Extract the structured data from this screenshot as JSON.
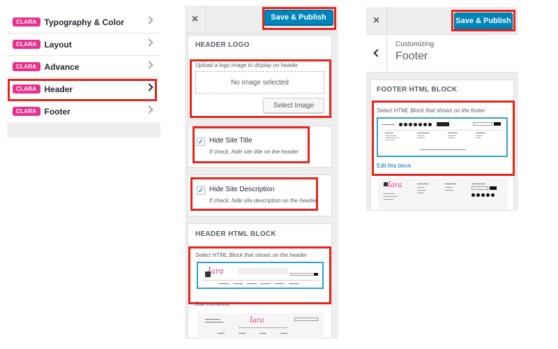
{
  "sections": {
    "badge": "CLARA",
    "items": [
      {
        "label": "Typography & Color"
      },
      {
        "label": "Layout"
      },
      {
        "label": "Advance"
      },
      {
        "label": "Header"
      },
      {
        "label": "Footer"
      }
    ]
  },
  "header_panel": {
    "close": "×",
    "publish": "Save & Publish",
    "logo": {
      "title": "HEADER LOGO",
      "description": "Upload a logo image to display on header",
      "placeholder": "No image selected",
      "select_button": "Select Image"
    },
    "hide_title": {
      "label": "Hide Site Title",
      "description": "If check, hide site title on the header",
      "checked": true
    },
    "hide_description": {
      "label": "Hide Site Description",
      "description": "If check, hide site description on the header",
      "checked": true
    },
    "html_block": {
      "title": "HEADER HTML BLOCK",
      "description": "Select HTML Block that shows on the header",
      "edit_link": "Edit this block"
    }
  },
  "footer_panel": {
    "close": "×",
    "publish": "Save & Publish",
    "breadcrumb": "Customizing",
    "title": "Footer",
    "html_block": {
      "title": "FOOTER HTML BLOCK",
      "description": "Select HTML Block that shows on the footer",
      "edit_link": "Edit this block"
    }
  },
  "checkmark": "✓",
  "accent_color": "#0085ba",
  "highlight_color": "#e8241a",
  "badge_color": "#e9308e"
}
